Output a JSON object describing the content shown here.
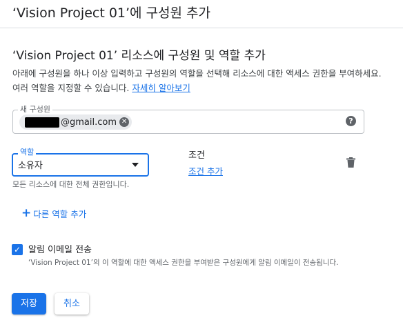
{
  "header": {
    "title": "‘Vision Project 01’에 구성원 추가"
  },
  "section": {
    "title": "‘Vision Project 01’ 리소스에 구성원 및 역할 추가",
    "description": "아래에 구성원을 하나 이상 입력하고 구성원의 역할을 선택해 리소스에 대한 액세스 권한을 부여하세요. 여러 역할을 지정할 수 있습니다.",
    "learn_more": "자세히 알아보기"
  },
  "members": {
    "label": "새 구성원",
    "chips": [
      {
        "text": "@gmail.com"
      }
    ],
    "help_icon": "help-icon"
  },
  "role": {
    "label": "역할",
    "value": "소유자",
    "hint": "모든 리소스에 대한 전체 권한입니다."
  },
  "condition": {
    "title": "조건",
    "add_link": "조건 추가"
  },
  "delete_icon": "trash-icon",
  "add_role": {
    "icon": "plus-icon",
    "label": "다른 역할 추가"
  },
  "notify": {
    "checked": true,
    "label": "알림 이메일 전송",
    "description": "‘Vision Project 01’의 이 역할에 대한 액세스 권한을 부여받은 구성원에게 알림 이메일이 전송됩니다."
  },
  "buttons": {
    "save": "저장",
    "cancel": "취소"
  },
  "colors": {
    "accent": "#1a73e8",
    "text": "#202124",
    "secondary_text": "#5f6368",
    "border": "#dadce0"
  }
}
